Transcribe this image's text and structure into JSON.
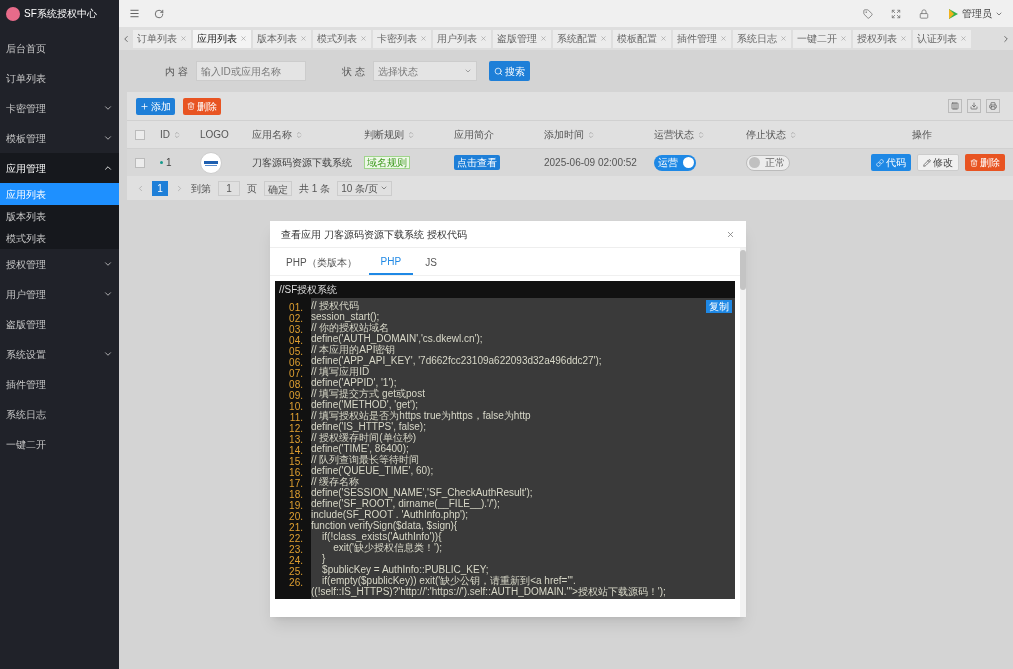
{
  "brand": {
    "title": "SF系统授权中心"
  },
  "sidebar": {
    "items": [
      {
        "label": "后台首页",
        "selected": false
      },
      {
        "label": "订单列表",
        "selected": false
      },
      {
        "label": "卡密管理",
        "expanded": false,
        "selected": false
      },
      {
        "label": "模板管理",
        "expanded": false,
        "selected": false
      },
      {
        "label": "应用管理",
        "expanded": true,
        "selected": false,
        "children": [
          {
            "label": "应用列表",
            "selected": true
          },
          {
            "label": "版本列表",
            "selected": false
          },
          {
            "label": "模式列表",
            "selected": false
          }
        ]
      },
      {
        "label": "授权管理",
        "expanded": false,
        "selected": false
      },
      {
        "label": "用户管理",
        "expanded": false,
        "selected": false
      },
      {
        "label": "盗版管理",
        "selected": false
      },
      {
        "label": "系统设置",
        "expanded": false,
        "selected": false
      },
      {
        "label": "插件管理",
        "selected": false
      },
      {
        "label": "系统日志",
        "selected": false
      },
      {
        "label": "一键二开",
        "selected": false
      }
    ]
  },
  "header": {
    "user": "管理员"
  },
  "tabs": [
    {
      "label": "订单列表",
      "selected": false
    },
    {
      "label": "应用列表",
      "selected": true
    },
    {
      "label": "版本列表",
      "selected": false
    },
    {
      "label": "模式列表",
      "selected": false
    },
    {
      "label": "卡密列表",
      "selected": false
    },
    {
      "label": "用户列表",
      "selected": false
    },
    {
      "label": "盗版管理",
      "selected": false
    },
    {
      "label": "系统配置",
      "selected": false
    },
    {
      "label": "模板配置",
      "selected": false
    },
    {
      "label": "插件管理",
      "selected": false
    },
    {
      "label": "系统日志",
      "selected": false
    },
    {
      "label": "一键二开",
      "selected": false
    },
    {
      "label": "授权列表",
      "selected": false
    },
    {
      "label": "认证列表",
      "selected": false
    }
  ],
  "search": {
    "content_label": "内 容",
    "content_placeholder": "输入ID或应用名称",
    "status_label": "状 态",
    "status_placeholder": "选择状态",
    "button": "搜索"
  },
  "toolbar": {
    "add": "添加",
    "delete": "删除"
  },
  "table": {
    "header_checked": false,
    "columns": [
      {
        "label": "ID",
        "sortable": true
      },
      {
        "label": "LOGO",
        "sortable": false
      },
      {
        "label": "应用名称",
        "sortable": true
      },
      {
        "label": "判断规则",
        "sortable": true
      },
      {
        "label": "应用简介",
        "sortable": false
      },
      {
        "label": "添加时间",
        "sortable": true
      },
      {
        "label": "运营状态",
        "sortable": true
      },
      {
        "label": "停止状态",
        "sortable": true
      },
      {
        "label": "操作",
        "sortable": false
      }
    ],
    "rows": [
      {
        "checked": false,
        "id": "1",
        "name": "刀客源码资源下载系统",
        "rule": "域名规则",
        "intro": "点击查看",
        "time": "2025-06-09 02:00:52",
        "running": {
          "label": "运营",
          "on": true
        },
        "stopped": {
          "label": "正常",
          "on": false
        },
        "actions": [
          "代码",
          "修改",
          "删除"
        ]
      }
    ]
  },
  "pagination": {
    "pages": [
      {
        "label": "1",
        "selected": true
      }
    ],
    "goto": "到第",
    "page_value": "1",
    "page_unit": "页",
    "confirm": "确定",
    "total": "共 1 条",
    "page_size": "10 条/页"
  },
  "modal": {
    "title": "查看应用 刀客源码资源下载系统 授权代码",
    "tabs": [
      {
        "label": "PHP（类版本）",
        "selected": false
      },
      {
        "label": "PHP",
        "selected": true
      },
      {
        "label": "JS",
        "selected": false
      }
    ],
    "code_title": "//SF授权系统",
    "copy": "复制",
    "lines": [
      {
        "num": "01.",
        "text": "// 授权代码"
      },
      {
        "num": "02.",
        "text": "session_start();"
      },
      {
        "num": "03.",
        "text": "// 你的授权站域名"
      },
      {
        "num": "04.",
        "text": "define('AUTH_DOMAIN','cs.dkewl.cn');"
      },
      {
        "num": "05.",
        "text": "// 本应用的API密钥"
      },
      {
        "num": "06.",
        "text": "define('APP_API_KEY', '7d662fcc23109a622093d32a496ddc27');"
      },
      {
        "num": "07.",
        "text": "// 填写应用ID"
      },
      {
        "num": "08.",
        "text": "define('APPID', '1');"
      },
      {
        "num": "09.",
        "text": "// 填写提交方式 get或post"
      },
      {
        "num": "10.",
        "text": "define('METHOD', 'get');"
      },
      {
        "num": "11.",
        "text": "// 填写授权站是否为https true为https，false为http"
      },
      {
        "num": "12.",
        "text": "define('IS_HTTPS', false);"
      },
      {
        "num": "13.",
        "text": "// 授权缓存时间(单位秒)"
      },
      {
        "num": "14.",
        "text": "define('TIME', 86400);"
      },
      {
        "num": "15.",
        "text": "// 队列查询最长等待时间"
      },
      {
        "num": "16.",
        "text": "define('QUEUE_TIME', 60);"
      },
      {
        "num": "17.",
        "text": "// 缓存名称"
      },
      {
        "num": "18.",
        "text": "define('SESSION_NAME','SF_CheckAuthResult');"
      },
      {
        "num": "19.",
        "text": "define('SF_ROOT', dirname(__FILE__).'/');"
      },
      {
        "num": "20.",
        "text": "include(SF_ROOT . 'AuthInfo.php');"
      },
      {
        "num": "21.",
        "text": "function verifySign($data, $sign){"
      },
      {
        "num": "22.",
        "text": "    if(!class_exists('AuthInfo')){"
      },
      {
        "num": "23.",
        "text": "        exit('缺少授权信息类！');"
      },
      {
        "num": "24.",
        "text": "    }"
      },
      {
        "num": "25.",
        "text": "    $publicKey = AuthInfo::PUBLIC_KEY;"
      },
      {
        "num": "26.",
        "text": "    if(empty($publicKey)) exit('缺少公钥，请重新到<a href=\"'."
      },
      {
        "text": "((!self::IS_HTTPS)?'http://':'https://').self::AUTH_DOMAIN.'\">授权站下载源码！');"
      }
    ]
  }
}
